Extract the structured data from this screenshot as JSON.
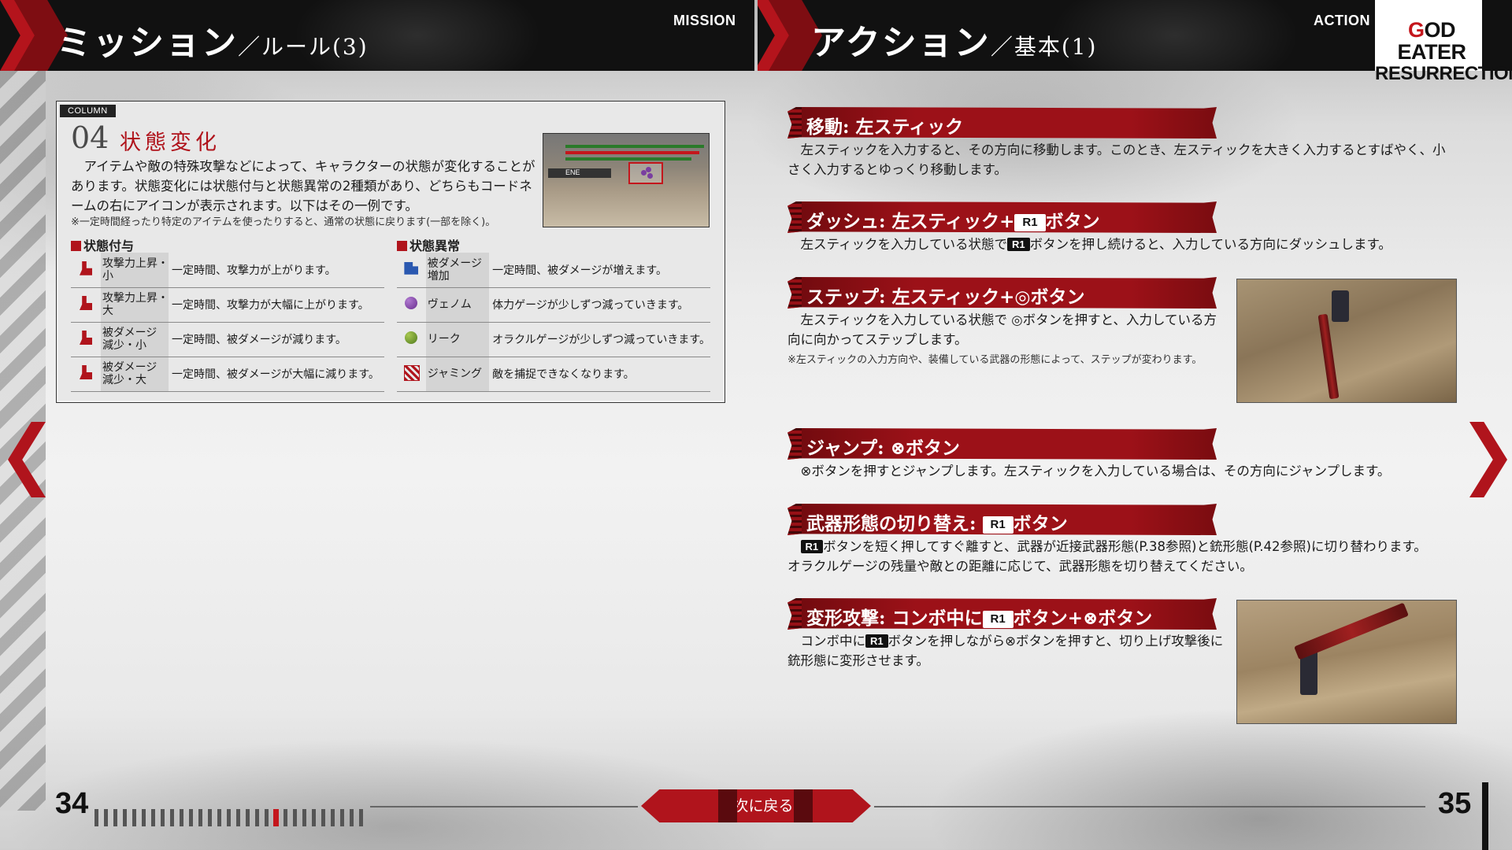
{
  "header": {
    "left_title": "ミッション",
    "left_subtitle": "／ルール(3)",
    "left_tag": "MISSION",
    "right_title": "アクション",
    "right_subtitle": "／基本(1)",
    "right_tag": "ACTION",
    "logo_g": "G",
    "logo_line1_rest": "OD EATER",
    "logo_line2": "RESURRECTION"
  },
  "column": {
    "tag": "COLUMN",
    "number": "04",
    "title": "状態変化",
    "body": "アイテムや敵の特殊攻撃などによって、キャラクターの状態が変化することがあります。状態変化には状態付与と状態異常の2種類があり、どちらもコードネームの右にアイコンが表示されます。以下はその一例です。",
    "note": "※一定時間経ったり特定のアイテムを使ったりすると、通常の状態に戻ります(一部を除く)。",
    "shot_label": "ENE",
    "buff_heading": "状態付与",
    "debuff_heading": "状態異常",
    "buffs": [
      {
        "icon": "attack-up-small-icon",
        "name_1": "攻撃力上昇・",
        "name_2": "小",
        "desc": "一定時間、攻撃力が上がります。"
      },
      {
        "icon": "attack-up-large-icon",
        "name_1": "攻撃力上昇・",
        "name_2": "大",
        "desc": "一定時間、攻撃力が大幅に上がります。"
      },
      {
        "icon": "damage-down-small-icon",
        "name_1": "被ダメージ",
        "name_2": "減少・小",
        "desc": "一定時間、被ダメージが減ります。"
      },
      {
        "icon": "damage-down-large-icon",
        "name_1": "被ダメージ",
        "name_2": "減少・大",
        "desc": "一定時間、被ダメージが大幅に減ります。"
      }
    ],
    "debuffs": [
      {
        "icon": "damage-up-icon",
        "name_1": "被ダメージ",
        "name_2": "増加",
        "desc": "一定時間、被ダメージが増えます。"
      },
      {
        "icon": "venom-icon",
        "name_1": "ヴェノム",
        "name_2": "",
        "desc": "体力ゲージが少しずつ減っていきます。"
      },
      {
        "icon": "leak-icon",
        "name_1": "リーク",
        "name_2": "",
        "desc": "オラクルゲージが少しずつ減っていきます。"
      },
      {
        "icon": "jamming-icon",
        "name_1": "ジャミング",
        "name_2": "",
        "desc": "敵を捕捉できなくなります。"
      }
    ]
  },
  "actions": {
    "move_title": "移動: 左スティック",
    "move_body": "左スティックを入力すると、その方向に移動します。このとき、左スティックを大きく入力するとすばやく、小さく入力するとゆっくり移動します。",
    "dash_title_1": "ダッシュ: 左スティック+",
    "dash_title_2": "ボタン",
    "dash_body_1": "左スティックを入力している状態で",
    "dash_body_2": "ボタンを押し続けると、入力している方向にダッシュします。",
    "step_title": "ステップ: 左スティック+◎ボタン",
    "step_body": "左スティックを入力している状態で ◎ボタンを押すと、入力している方向に向かってステップします。",
    "step_note": "※左スティックの入力方向や、装備している武器の形態によって、ステップが変わります。",
    "jump_title": "ジャンプ: ⊗ボタン",
    "jump_body": "⊗ボタンを押すとジャンプします。左スティックを入力している場合は、その方向にジャンプします。",
    "switch_title_1": "武器形態の切り替え: ",
    "switch_title_2": "ボタン",
    "switch_body_1": "ボタンを短く押してすぐ離すと、武器が近接武器形態(P.38参照)と銃形態(P.42参照)に切り替わります。",
    "switch_body_2": "オラクルゲージの残量や敵との距離に応じて、武器形態を切り替えてください。",
    "transform_title_1": "変形攻撃: コンボ中に",
    "transform_title_2": "ボタン+⊗ボタン",
    "transform_body_1": "コンボ中に",
    "transform_body_2": "ボタンを押しながら⊗ボタンを押すと、切り上げ攻撃後に銃形態に変形させます。",
    "r1_label": "R1"
  },
  "footer": {
    "left_page": "34",
    "right_page": "35",
    "back_label": "目次に戻る"
  },
  "colors": {
    "accent": "#b0141c",
    "header_bg": "#111111"
  }
}
